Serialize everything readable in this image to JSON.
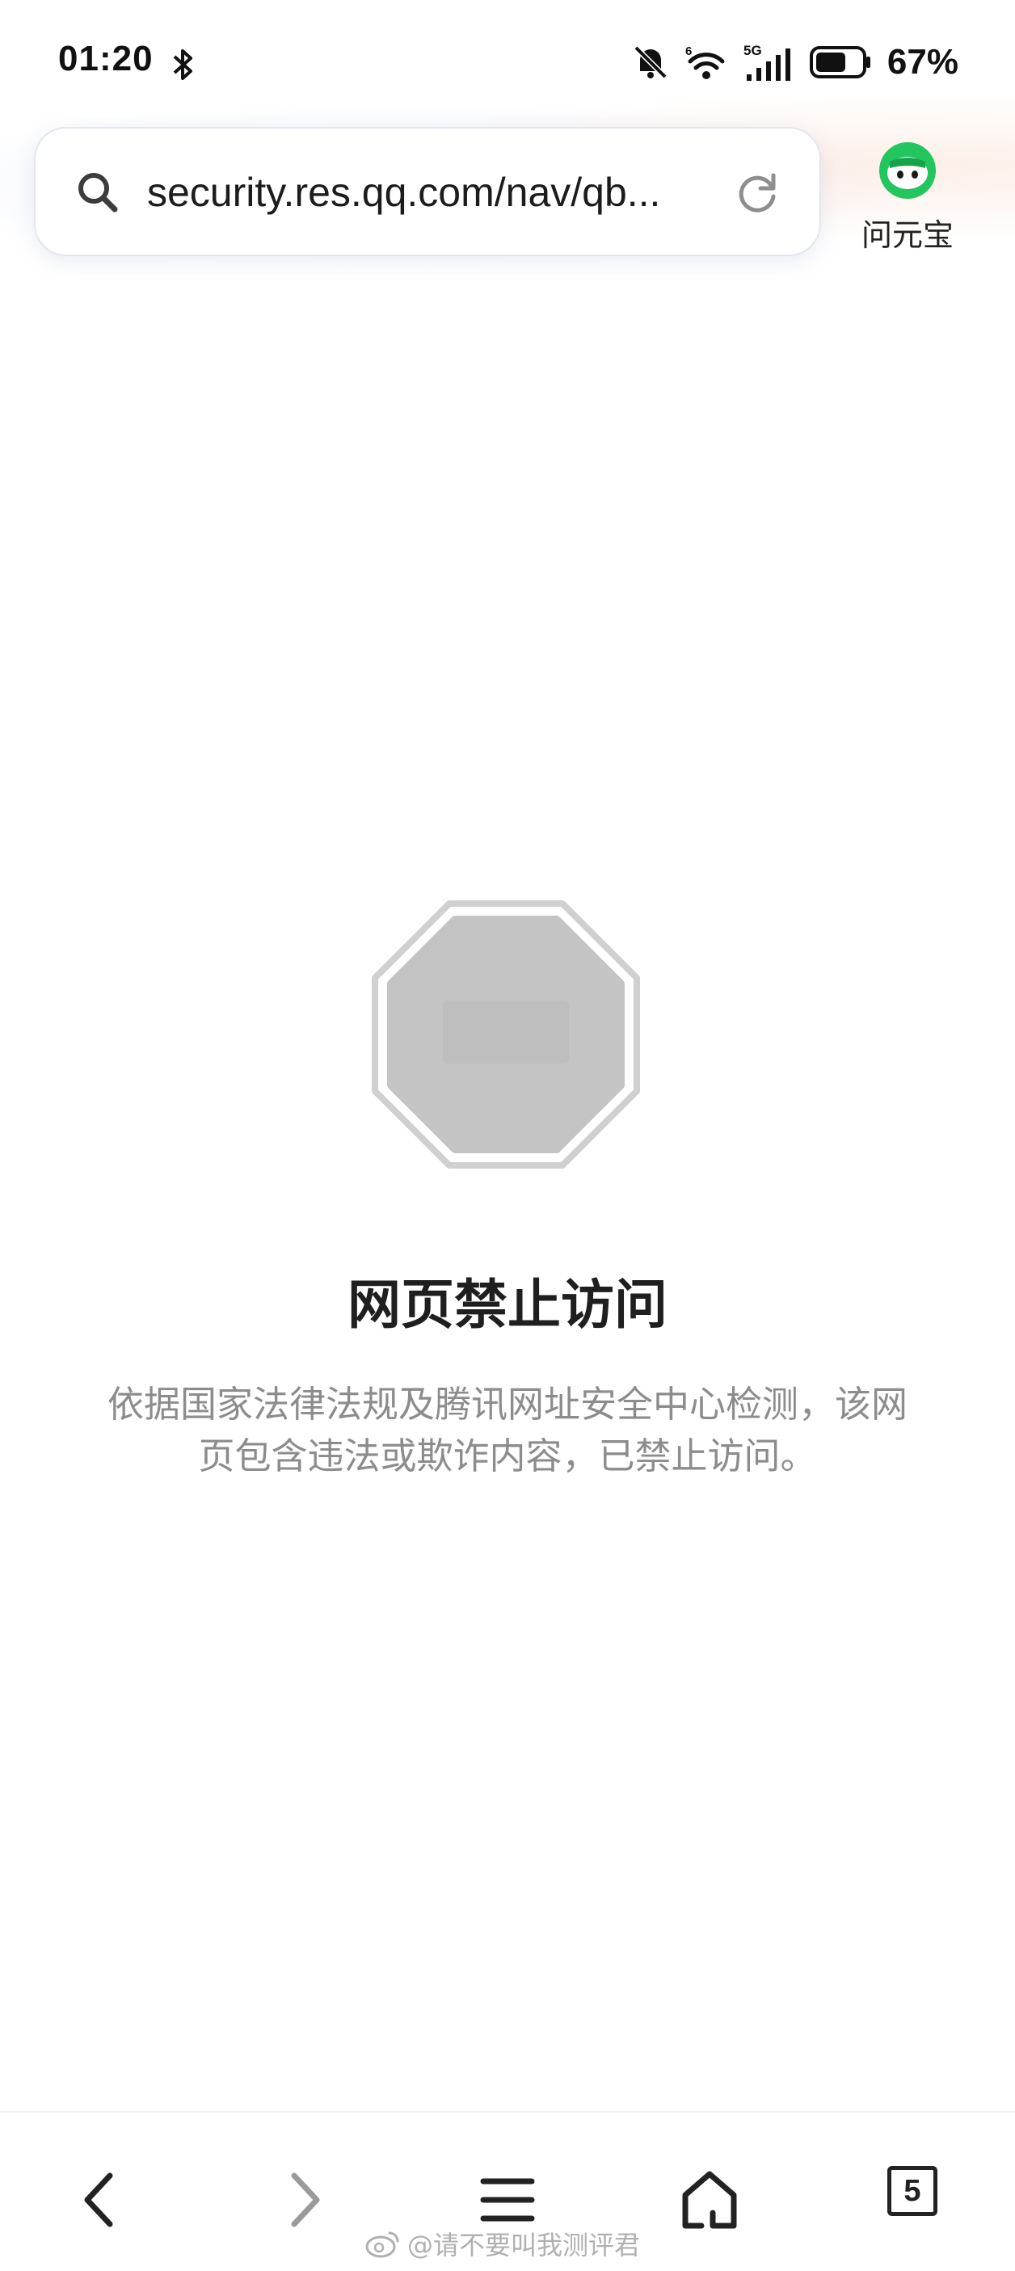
{
  "status_bar": {
    "time": "01:20",
    "network": "5G",
    "wifi_label": "6",
    "battery_percent": "67%",
    "battery_level": 0.67,
    "icons": [
      "bluetooth-icon",
      "mute-bell-icon",
      "wifi-icon",
      "signal-icon",
      "battery-icon"
    ]
  },
  "address_bar": {
    "url": "security.res.qq.com/nav/qb...",
    "search_icon": "search-icon",
    "reload_icon": "reload-icon"
  },
  "assistant": {
    "label": "问元宝",
    "icon": "yuanbao-avatar-icon",
    "color": "#22c55e"
  },
  "main": {
    "title": "网页禁止访问",
    "description": "依据国家法律法规及腾讯网址安全中心检测，该网页包含违法或欺诈内容，已禁止访问。",
    "icon": "stop-sign-icon",
    "icon_color": "#c4c4c4"
  },
  "bottom_nav": {
    "items": [
      "back-icon",
      "forward-icon",
      "menu-icon",
      "home-icon",
      "tabs-icon"
    ],
    "tab_count": "5"
  },
  "watermark": {
    "text": "@请不要叫我测评君"
  }
}
